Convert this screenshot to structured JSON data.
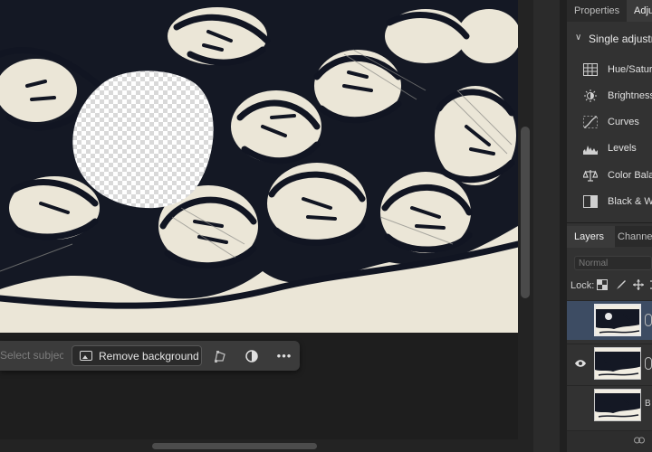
{
  "taskbar": {
    "select_subject_label": "Select subject",
    "remove_background_label": "Remove background",
    "more_label": "•••",
    "icons": [
      "image-icon",
      "transform-icon",
      "adjustment-icon",
      "more-icon"
    ]
  },
  "panel": {
    "top_tabs": [
      {
        "label": "Properties",
        "active": false
      },
      {
        "label": "Adjustments",
        "active": true
      }
    ],
    "adjustments_header": "Single adjustments",
    "adjustments": [
      {
        "label": "Hue/Saturation",
        "icon": "hue-saturation-icon"
      },
      {
        "label": "Brightness/Contrast",
        "icon": "brightness-icon"
      },
      {
        "label": "Curves",
        "icon": "curves-icon"
      },
      {
        "label": "Levels",
        "icon": "levels-icon"
      },
      {
        "label": "Color Balance",
        "icon": "color-balance-icon"
      },
      {
        "label": "Black & White",
        "icon": "black-white-icon"
      }
    ],
    "layer_tabs": [
      {
        "label": "Layers",
        "active": true
      },
      {
        "label": "Channels",
        "active": false
      }
    ],
    "blend_mode": "Normal",
    "lock_label": "Lock:",
    "layers": [
      {
        "name": "",
        "visible": false,
        "selected": true
      },
      {
        "name": "",
        "visible": true,
        "selected": false
      },
      {
        "name": "B",
        "visible": false,
        "selected": false
      }
    ]
  },
  "colors": {
    "canvas_bg": "#1f1f1f",
    "panel_bg": "#323232",
    "selection": "#3d4c63",
    "paper": "#ebe6d7",
    "ink": "#111522"
  }
}
